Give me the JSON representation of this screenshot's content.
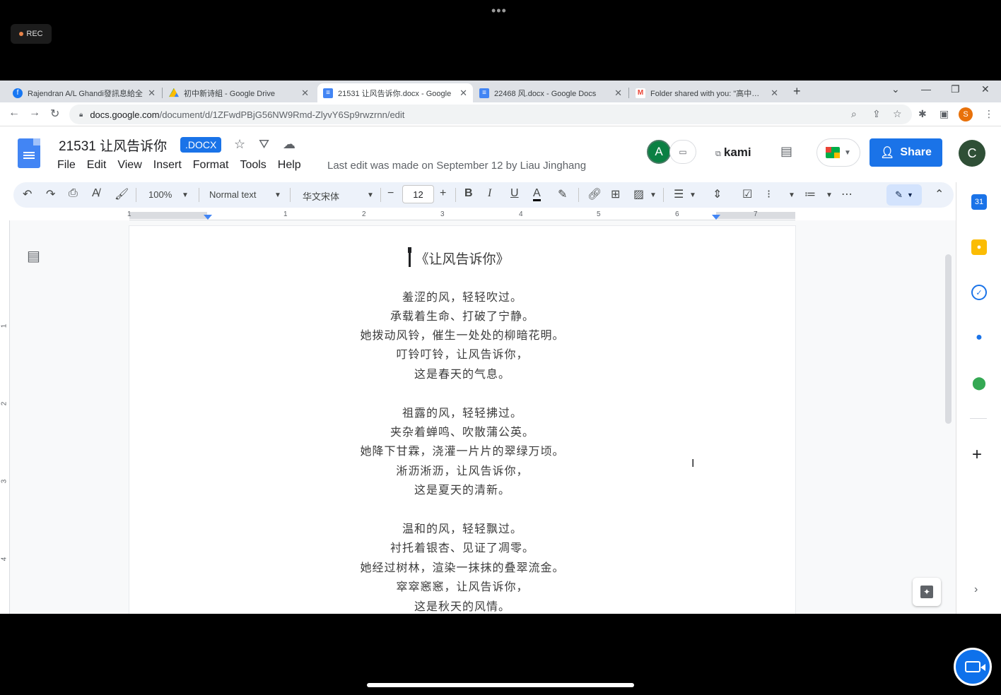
{
  "recording": {
    "label": "REC"
  },
  "tabs": [
    {
      "label": "Rajendran A/L Ghandi發訊息給全",
      "icon": "facebook-icon",
      "color": "#1877f2"
    },
    {
      "label": "初中新诗組 - Google Drive",
      "icon": "google-drive-icon",
      "color": "#fbbc04"
    },
    {
      "label": "21531 让风告诉你.docx - Google",
      "icon": "google-docs-icon",
      "color": "#4285f4"
    },
    {
      "label": "22468 风.docx - Google Docs",
      "icon": "google-docs-icon",
      "color": "#4285f4"
    },
    {
      "label": "Folder shared with you: \"高中新诗",
      "icon": "gmail-icon",
      "color": "#ea4335"
    }
  ],
  "address": {
    "host": "docs.google.com",
    "path": "/document/d/1ZFwdPBjG56NW9Rmd-ZlyvY6Sp9rwzrnn/edit"
  },
  "profile": {
    "initial": "S"
  },
  "doc": {
    "title": "21531 让风告诉你",
    "badge": ".DOCX",
    "last_edit": "Last edit was made on September 12 by Liau Jinghang"
  },
  "menu": [
    "File",
    "Edit",
    "View",
    "Insert",
    "Format",
    "Tools",
    "Help"
  ],
  "collaborators": {
    "avatar_initial": "A",
    "user_initial": "C"
  },
  "kami": {
    "label": "kami"
  },
  "share": {
    "label": "Share"
  },
  "toolbar": {
    "zoom": "100%",
    "style": "Normal text",
    "font": "华文宋体",
    "font_size": "12"
  },
  "ruler": {
    "numbers": [
      "1",
      "1",
      "2",
      "3",
      "4",
      "5",
      "6",
      "7"
    ],
    "vnumbers": [
      "1",
      "2",
      "3",
      "4"
    ]
  },
  "poem": {
    "title": "《让风告诉你》",
    "stanzas": [
      [
        "羞涩的风，轻轻吹过。",
        "承载着生命、打破了宁静。",
        "她拨动风铃，催生一处处的柳暗花明。",
        "叮铃叮铃，让风告诉你，",
        "这是春天的气息。"
      ],
      [
        "祖露的风，轻轻拂过。",
        "夹杂着蝉鸣、吹散蒲公英。",
        "她降下甘霖，浇灌一片片的翠绿万顷。",
        "淅沥淅沥，让风告诉你，",
        "这是夏天的清新。"
      ],
      [
        "温和的风，轻轻飘过。",
        "衬托着银杏、见证了凋零。",
        "她经过树林，渲染一抹抹的叠翠流金。",
        "窣窣窸窸，让风告诉你，",
        "这是秋天的风情。"
      ]
    ]
  },
  "side_panel": [
    {
      "name": "calendar-icon",
      "color": "#1a73e8",
      "text": "31"
    },
    {
      "name": "keep-icon",
      "color": "#fbbc04",
      "text": ""
    },
    {
      "name": "tasks-icon",
      "color": "#1a73e8",
      "text": "✓"
    },
    {
      "name": "contacts-icon",
      "color": "#1a73e8",
      "text": ""
    },
    {
      "name": "maps-icon",
      "color": "#34a853",
      "text": ""
    }
  ]
}
